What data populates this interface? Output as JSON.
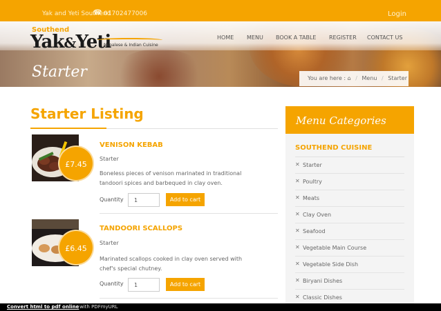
{
  "topbar": {
    "brand": "Yak and Yeti Southend",
    "phone_icon": "phone-icon",
    "phone": "01702477006",
    "login": "Login"
  },
  "logo": {
    "small": "Southend",
    "main_left": "Yak",
    "amp": "&",
    "main_right": "Yeti",
    "tagline": "Nepalese & Indian Cuisine"
  },
  "nav": [
    "HOME",
    "MENU",
    "BOOK A TABLE",
    "REGISTER",
    "CONTACT US"
  ],
  "hero": {
    "title": "Starter",
    "breadcrumb": {
      "prefix": "You are here :",
      "home_icon": "home-icon",
      "items": [
        "Menu",
        "Starter"
      ]
    }
  },
  "listing": {
    "title": "Starter Listing",
    "quantity_label": "Quantity",
    "add_to_cart": "Add to cart",
    "items": [
      {
        "name": "VENISON KEBAB",
        "price": "£7.45",
        "category": "Starter",
        "description": "Boneless pieces of venison marinated in traditional tandoori spices and barbequed in clay oven.",
        "quantity": "1"
      },
      {
        "name": "TANDOORI SCALLOPS",
        "price": "£6.45",
        "category": "Starter",
        "description": "Marinated scallops cooked in clay oven served with chef's special chutney.",
        "quantity": "1"
      }
    ]
  },
  "sidebar": {
    "title": "Menu Categories",
    "section": "SOUTHEND CUISINE",
    "category_icon": "cutlery-icon",
    "categories": [
      "Starter",
      "Poultry",
      "Meats",
      "Clay Oven",
      "Seafood",
      "Vegetable Main Course",
      "Vegetable Side Dish",
      "Biryani Dishes",
      "Classic Dishes"
    ]
  },
  "footer": {
    "link": "Convert html to pdf online",
    "rest": "with PDFmyURL"
  },
  "colors": {
    "accent": "#f5a400",
    "footer_bg": "#000000"
  }
}
